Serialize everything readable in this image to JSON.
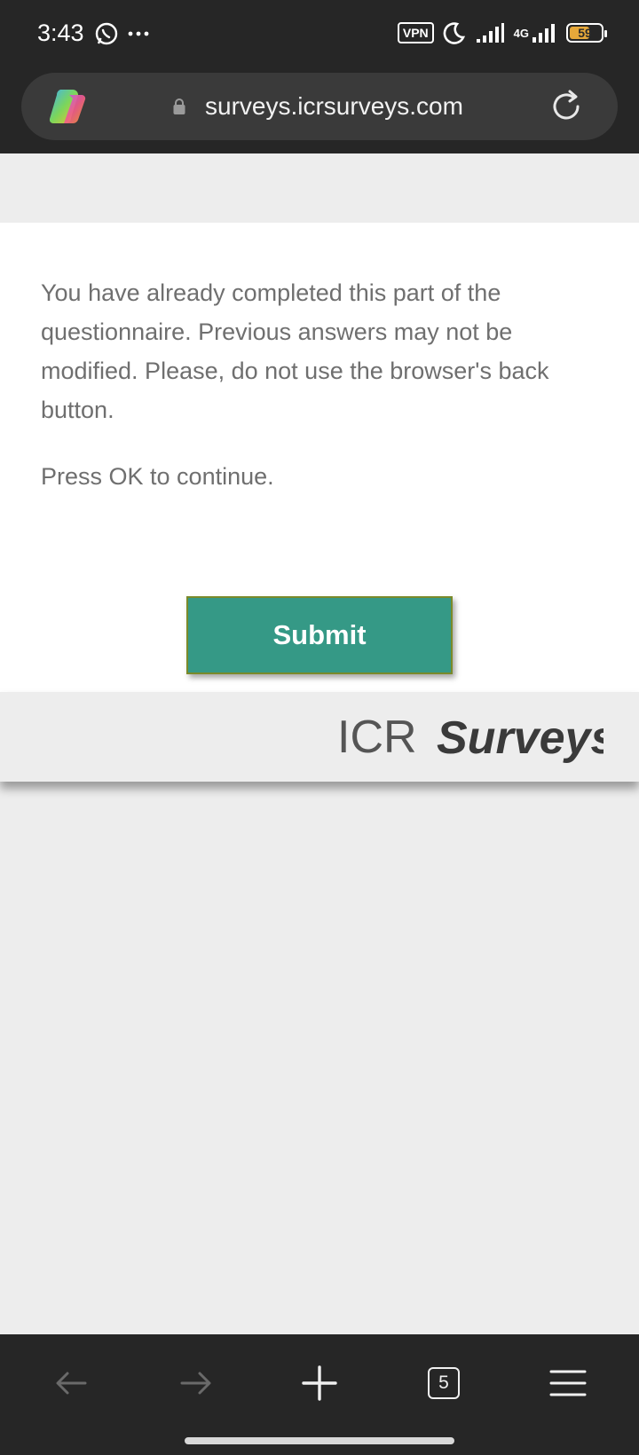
{
  "status_bar": {
    "time": "3:43",
    "vpn_label": "VPN",
    "network_label": "4G",
    "battery_level": "59",
    "battery_fraction": 0.59
  },
  "browser": {
    "url": "surveys.icrsurveys.com",
    "tab_count": "5"
  },
  "page": {
    "message": "You have already completed this part of the questionnaire. Previous answers may not be modified. Please, do not use the browser's back button.",
    "instruction": "Press OK to continue.",
    "submit_label": "Submit",
    "logo_text_left": "ICR",
    "logo_text_right": "Surveys"
  },
  "colors": {
    "submit_bg": "#359986",
    "browser_chrome": "#262626",
    "battery_fill": "#e6a83a"
  },
  "icons": [
    "whatsapp-icon",
    "more-icon",
    "moon-icon",
    "signal-icon",
    "copilot-icon",
    "lock-icon",
    "reload-icon",
    "back-icon",
    "forward-icon",
    "new-tab-icon",
    "tabs-icon",
    "menu-icon"
  ]
}
